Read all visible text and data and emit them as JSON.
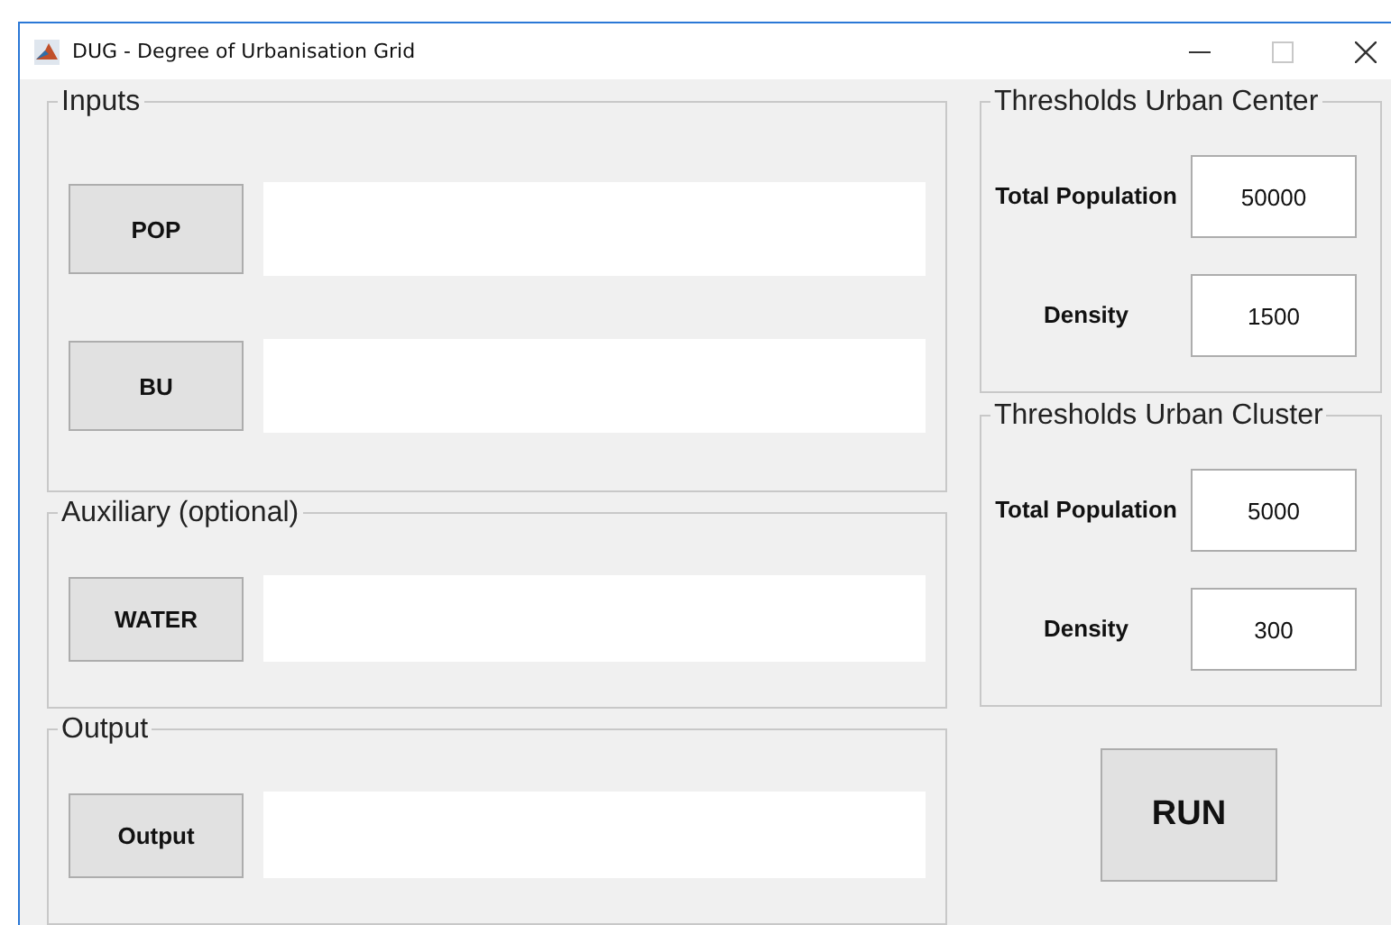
{
  "window": {
    "title": "DUG - Degree of Urbanisation Grid",
    "maximize_disabled": true
  },
  "left_panels": [
    {
      "title": "Inputs",
      "rows": [
        {
          "button": "POP",
          "value": ""
        },
        {
          "button": "BU",
          "value": ""
        }
      ]
    },
    {
      "title": "Auxiliary (optional)",
      "rows": [
        {
          "button": "WATER",
          "value": ""
        }
      ]
    },
    {
      "title": "Output",
      "rows": [
        {
          "button": "Output",
          "value": ""
        }
      ]
    }
  ],
  "right_panels": [
    {
      "title": "Thresholds Urban Center",
      "fields": [
        {
          "label": "Total Population",
          "value": "50000"
        },
        {
          "label": "Density",
          "value": "1500"
        }
      ]
    },
    {
      "title": "Thresholds Urban Cluster",
      "fields": [
        {
          "label": "Total Population",
          "value": "5000"
        },
        {
          "label": "Density",
          "value": "300"
        }
      ]
    }
  ],
  "run_button": "RUN"
}
